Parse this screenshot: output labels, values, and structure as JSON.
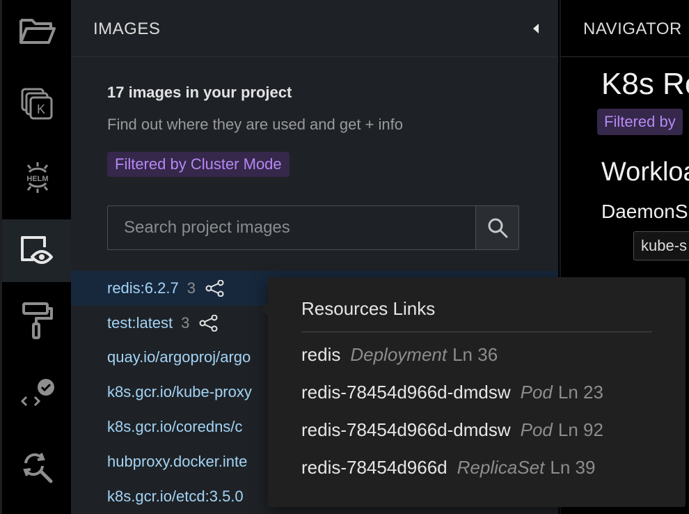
{
  "activity_bar": {
    "items": [
      {
        "name": "folder-icon",
        "active": false
      },
      {
        "name": "k8s-resources-icon",
        "active": false
      },
      {
        "name": "helm-icon",
        "active": false
      },
      {
        "name": "images-eye-icon",
        "active": true
      },
      {
        "name": "paint-roller-icon",
        "active": false
      },
      {
        "name": "code-validation-icon",
        "active": false
      },
      {
        "name": "search-refresh-icon",
        "active": false
      }
    ],
    "helm_text": "HELM",
    "k_text": "K"
  },
  "images_pane": {
    "title": "IMAGES",
    "count_text": "17 images in your project",
    "subtitle": "Find out where they are used and get + info",
    "filter_tag": "Filtered by Cluster Mode",
    "search_placeholder": "Search project images",
    "images": [
      {
        "name": "redis:6.2.7",
        "count": "3",
        "selected": true
      },
      {
        "name": "test:latest",
        "count": "3",
        "selected": false
      },
      {
        "name": "quay.io/argoproj/argo",
        "count": "",
        "selected": false
      },
      {
        "name": "k8s.gcr.io/kube-proxy",
        "count": "",
        "selected": false
      },
      {
        "name": "k8s.gcr.io/coredns/c",
        "count": "",
        "selected": false
      },
      {
        "name": "hubproxy.docker.inte",
        "count": "",
        "selected": false
      },
      {
        "name": "k8s.gcr.io/etcd:3.5.0",
        "count": "",
        "selected": false
      }
    ]
  },
  "navigator": {
    "title": "NAVIGATOR",
    "heading": "K8s Re",
    "filter_tag": "Filtered by",
    "section": "Workloa",
    "subsection": "DaemonS",
    "chip": "kube-s"
  },
  "popover": {
    "title": "Resources Links",
    "links": [
      {
        "name": "redis",
        "kind": "Deployment",
        "line": "Ln 36"
      },
      {
        "name": "redis-78454d966d-dmdsw",
        "kind": "Pod",
        "line": "Ln 23"
      },
      {
        "name": "redis-78454d966d-dmdsw",
        "kind": "Pod",
        "line": "Ln 92"
      },
      {
        "name": "redis-78454d966d",
        "kind": "ReplicaSet",
        "line": "Ln 39"
      }
    ]
  },
  "colors": {
    "accent_purple": "#b688f2",
    "tag_bg": "#35284b",
    "link_blue": "#a4d3f5",
    "selected_row": "#17283c"
  }
}
